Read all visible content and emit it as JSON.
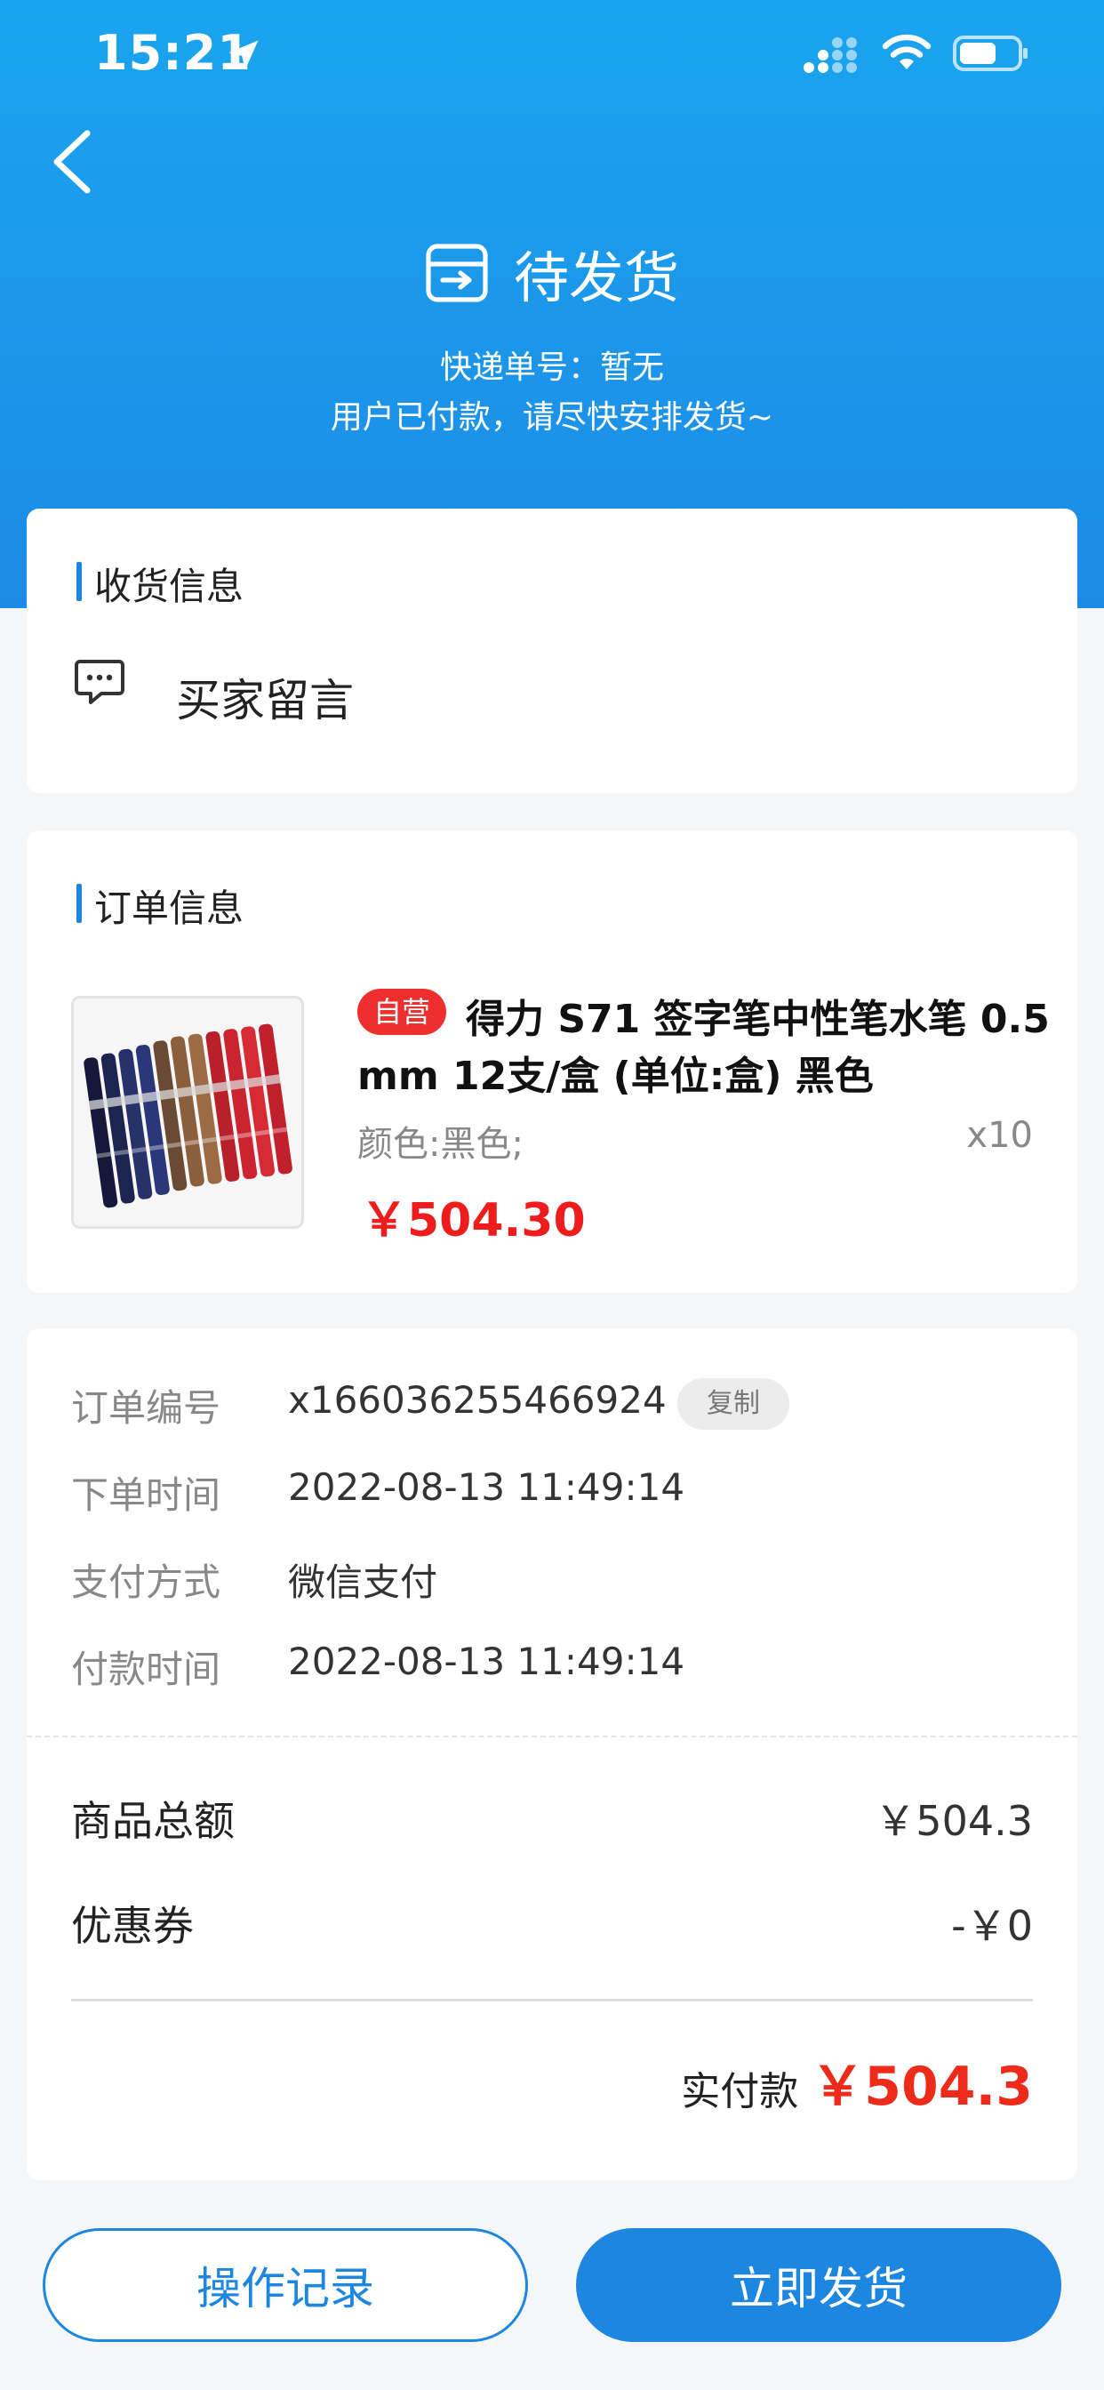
{
  "status_bar": {
    "time": "15:21"
  },
  "header": {
    "status_title": "待发货",
    "tracking_text": "快递单号：暂无",
    "hint_text": "用户已付款，请尽快安排发货~"
  },
  "receive": {
    "section_title": "收货信息",
    "buyer_message_label": "买家留言"
  },
  "order": {
    "section_title": "订单信息",
    "product": {
      "badge": "自营",
      "name_line1": "得力 S71 签字笔中性笔水笔 0.5",
      "name_line2": "mm 12支/盒 (单位:盒) 黑色",
      "spec": "颜色:黑色;",
      "quantity": "x10",
      "price": "￥504.30"
    }
  },
  "details": {
    "order_no_label": "订单编号",
    "order_no_value": "x166036255466924",
    "copy_label": "复制",
    "order_time_label": "下单时间",
    "order_time_value": "2022-08-13 11:49:14",
    "pay_method_label": "支付方式",
    "pay_method_value": "微信支付",
    "pay_time_label": "付款时间",
    "pay_time_value": "2022-08-13 11:49:14",
    "goods_total_label": "商品总额",
    "goods_total_value": "￥504.3",
    "coupon_label": "优惠券",
    "coupon_value": "-￥0",
    "paid_label": "实付款",
    "paid_value": "￥504.3"
  },
  "actions": {
    "log_label": "操作记录",
    "ship_label": "立即发货"
  },
  "colors": {
    "primary": "#1d86e0",
    "price_red": "#ee1c1c"
  }
}
